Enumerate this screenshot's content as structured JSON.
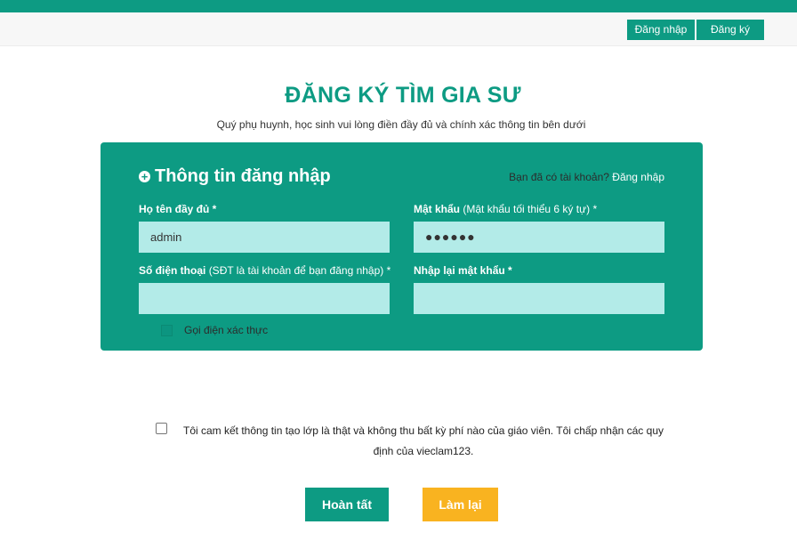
{
  "header": {
    "login_label": "Đăng nhập",
    "register_label": "Đăng ký"
  },
  "page": {
    "title": "ĐĂNG KÝ TÌM GIA SƯ",
    "subtitle": "Quý phụ huynh, học sinh vui lòng điền đầy đủ và chính xác thông tin bên dưới"
  },
  "panel": {
    "title": "Thông tin đăng nhập",
    "have_account_text": "Bạn đã có tài khoản?",
    "have_account_link": "Đăng nhập",
    "fields": {
      "fullname": {
        "label": "Họ tên đầy đủ *",
        "value": "admin"
      },
      "password": {
        "label": "Mật khẩu",
        "hint": "(Mật khẩu tối thiểu 6 ký tự) *",
        "value": "●●●●●●"
      },
      "phone": {
        "label": "Số điện thoại",
        "hint": "(SĐT là tài khoản để bạn đăng nhập) *",
        "value": ""
      },
      "repassword": {
        "label": "Nhập lại mật khẩu *",
        "value": ""
      }
    },
    "verify_call_label": "Gọi điện xác thực"
  },
  "agreement": {
    "text": "Tôi cam kết thông tin tạo lớp là thật và không thu bất kỳ phí nào của giáo viên. Tôi chấp nhận các quy định của vieclam123."
  },
  "actions": {
    "finish_label": "Hoàn tất",
    "reset_label": "Làm lại"
  },
  "colors": {
    "primary": "#0d9b83",
    "input_bg": "#b3ebe8",
    "reset_button": "#f9b320"
  }
}
